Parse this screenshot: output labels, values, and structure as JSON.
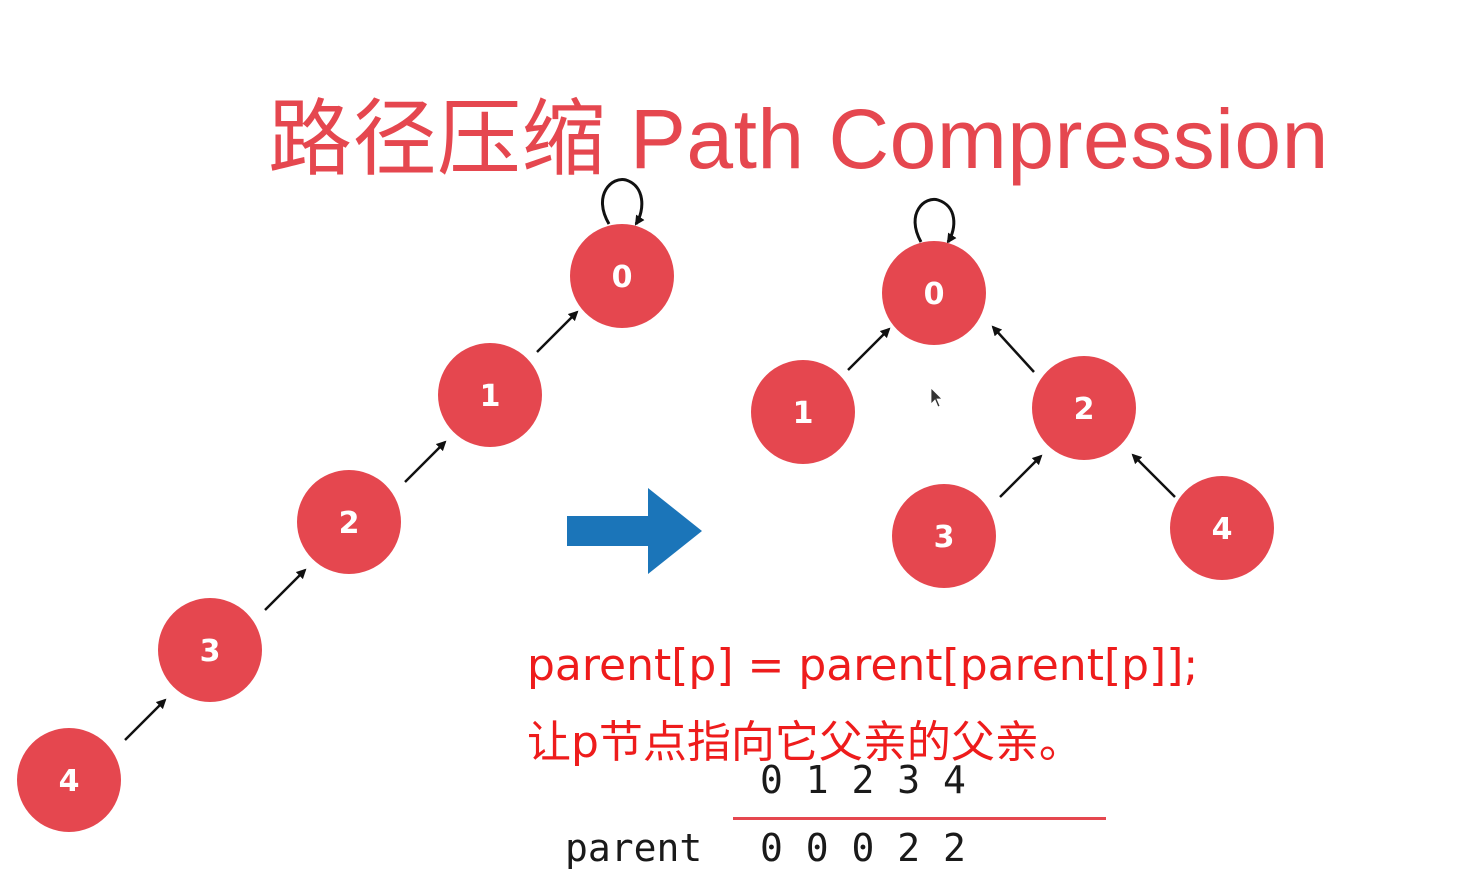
{
  "title": "路径压缩 Path Compression",
  "colors": {
    "node_fill": "#e5474f",
    "title": "#e5474f",
    "code_text": "#ee1c1c",
    "arrow": "#1b75b9",
    "edge": "#111111"
  },
  "diagram_before": {
    "nodes": [
      "0",
      "1",
      "2",
      "3",
      "4"
    ],
    "edges": [
      [
        "4",
        "3"
      ],
      [
        "3",
        "2"
      ],
      [
        "2",
        "1"
      ],
      [
        "1",
        "0"
      ]
    ],
    "root_self_loop": "0"
  },
  "diagram_after": {
    "nodes": [
      "0",
      "1",
      "2",
      "3",
      "4"
    ],
    "edges": [
      [
        "1",
        "0"
      ],
      [
        "2",
        "0"
      ],
      [
        "3",
        "2"
      ],
      [
        "4",
        "2"
      ]
    ],
    "root_self_loop": "0"
  },
  "transition_arrow": "right-arrow-icon",
  "code_line": "parent[p] = parent[parent[p]];",
  "caption": "让p节点指向它父亲的父亲。",
  "table": {
    "indices": "0 1 2 3 4",
    "row_label": "parent",
    "parent_values": "0 0 0 2 2"
  }
}
